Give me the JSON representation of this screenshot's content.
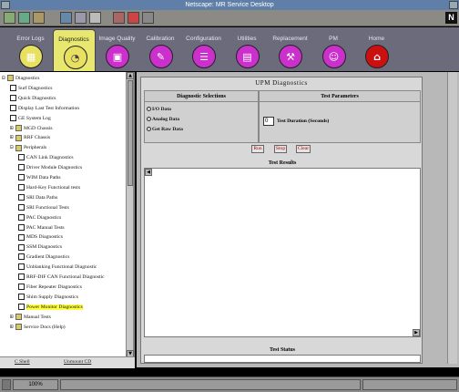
{
  "window": {
    "title": "Netscape: MR Service Desktop"
  },
  "toolbar": {
    "logo_text": "N"
  },
  "tabs": [
    {
      "label": "Error Logs",
      "icon": "grid-icon",
      "color": "#e8e060",
      "active": false
    },
    {
      "label": "Diagnostics",
      "icon": "gauge-icon",
      "color": "#e8e060",
      "active": true
    },
    {
      "label": "Image Quality",
      "icon": "image-icon",
      "color": "#cc30cc",
      "active": false
    },
    {
      "label": "Calibration",
      "icon": "pen-icon",
      "color": "#cc30cc",
      "active": false
    },
    {
      "label": "Configuration",
      "icon": "config-icon",
      "color": "#cc30cc",
      "active": false
    },
    {
      "label": "Utilities",
      "icon": "toolbox-icon",
      "color": "#cc30cc",
      "active": false
    },
    {
      "label": "Replacement",
      "icon": "wrench-icon",
      "color": "#cc30cc",
      "active": false
    },
    {
      "label": "PM",
      "icon": "people-icon",
      "color": "#cc30cc",
      "active": false
    },
    {
      "label": "Home",
      "icon": "house-icon",
      "color": "#cc1010",
      "active": false
    }
  ],
  "tree": [
    {
      "label": "Diagnostics",
      "type": "folder",
      "pm": "-",
      "level": 0
    },
    {
      "label": "Surf Diagnostics",
      "type": "doc",
      "level": 1
    },
    {
      "label": "Quick Diagnostics",
      "type": "doc",
      "level": 1
    },
    {
      "label": "Display Last Test Information",
      "type": "doc",
      "level": 1
    },
    {
      "label": "GE System Log",
      "type": "doc",
      "level": 1
    },
    {
      "label": "MGD Chassis",
      "type": "folder",
      "pm": "+",
      "level": 1
    },
    {
      "label": "RRF Chassis",
      "type": "folder",
      "pm": "+",
      "level": 1
    },
    {
      "label": "Peripherals",
      "type": "folder",
      "pm": "-",
      "level": 1
    },
    {
      "label": "CAN Link Diagnostics",
      "type": "doc",
      "level": 2
    },
    {
      "label": "Driver Module Diagnostics",
      "type": "doc",
      "level": 2
    },
    {
      "label": "WIM Data Paths",
      "type": "doc",
      "level": 2
    },
    {
      "label": "Hard-Key Functional tests",
      "type": "doc",
      "level": 2
    },
    {
      "label": "SRI Data Paths",
      "type": "doc",
      "level": 2
    },
    {
      "label": "SRI Functional Tests",
      "type": "doc",
      "level": 2
    },
    {
      "label": "PAC Diagnostics",
      "type": "doc",
      "level": 2
    },
    {
      "label": "PAC Manual Tests",
      "type": "doc",
      "level": 2
    },
    {
      "label": "MDS Diagnostics",
      "type": "doc",
      "level": 2
    },
    {
      "label": "SSM Diagnostics",
      "type": "doc",
      "level": 2
    },
    {
      "label": "Gradient Diagnostics",
      "type": "doc",
      "level": 2
    },
    {
      "label": "Unblanking Functional Diagnostic",
      "type": "doc",
      "level": 2
    },
    {
      "label": "RRF-DIF CAN Functional Diagnostic",
      "type": "doc",
      "level": 2
    },
    {
      "label": "Fiber Repeater Diagnostics",
      "type": "doc",
      "level": 2
    },
    {
      "label": "Shim Supply Diagnostics",
      "type": "doc",
      "level": 2
    },
    {
      "label": "Power Monitor Diagnostics",
      "type": "doc",
      "level": 2,
      "selected": true
    },
    {
      "label": "Manual Tests",
      "type": "folder",
      "pm": "+",
      "level": 1
    },
    {
      "label": "Service Docs (Help)",
      "type": "folder",
      "pm": "+",
      "level": 1
    }
  ],
  "sidebar_buttons": {
    "shell": "C Shell",
    "unmount": "Unmount CD"
  },
  "panel": {
    "title": "UPM Diagnostics",
    "selections_header": "Diagnostic Selections",
    "parameters_header": "Test Parameters",
    "options": [
      "I/O Data",
      "Analog Data",
      "Get Raw Data"
    ],
    "duration_value": "0",
    "duration_label": "Test Duration (Seconds)",
    "run": "Run",
    "stop": "Stop",
    "clear": "Clear",
    "results_header": "Test Results",
    "status_header": "Test Status"
  },
  "statusbar": {
    "zoom": "100%"
  }
}
